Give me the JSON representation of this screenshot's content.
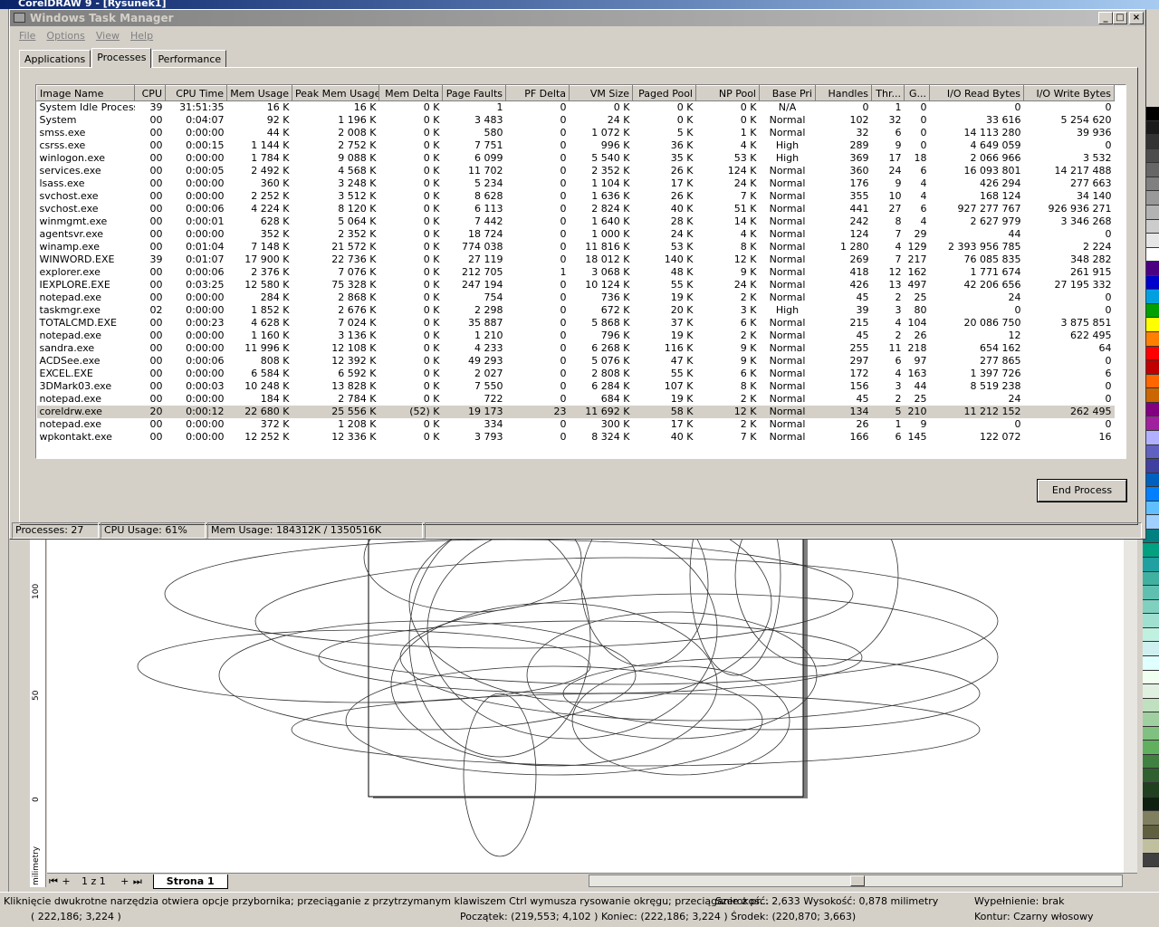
{
  "corel": {
    "title": "CorelDRAW 9 - [Rysunek1]",
    "ruler_unit": "milimetry",
    "ruler_ticks": [
      "100",
      "50",
      "0"
    ],
    "page_counter": "1 z 1",
    "page_tab": "Strona 1",
    "status_hint": "Kliknięcie dwukrotne narzędzia otwiera opcje przybornika; przeciąganie z przytrzymanym klawiszem Ctrl wymusza rysowanie okręgu; przeciąganie z pr...",
    "status_size": "Szerokość: 2,633  Wysokość: 0,878 milimetry",
    "status_fill": "Wypełnienie: brak",
    "status_cursor": "( 222,186; 3,224 )",
    "status_coords": "Początek: (219,553; 4,102 )  Koniec: (222,186; 3,224 )  Środek: (220,870; 3,663)",
    "status_outline": "Kontur:  Czarny włosowy",
    "palette": [
      "#000000",
      "#1a1a1a",
      "#333333",
      "#4d4d4d",
      "#666666",
      "#808080",
      "#999999",
      "#b3b3b3",
      "#cccccc",
      "#e6e6e6",
      "#ffffff",
      "#4b0082",
      "#0000cd",
      "#00a0e0",
      "#00a000",
      "#ffff00",
      "#ff8000",
      "#ff0000",
      "#c00000",
      "#ff6600",
      "#cc6600",
      "#800080",
      "#a020a0",
      "#b0b0ff",
      "#6060c0",
      "#4040a0",
      "#0060c0",
      "#0080ff",
      "#60c0ff",
      "#a0d0ff",
      "#008080",
      "#00a080",
      "#20a0a0",
      "#40b0a0",
      "#60c0b0",
      "#80d0c0",
      "#a0e0d0",
      "#c0f0e0",
      "#d0f0f0",
      "#e0ffff",
      "#f0fff0",
      "#e0f0e0",
      "#c0e0c0",
      "#a0d0a0",
      "#80c080",
      "#60b060",
      "#408040",
      "#306030",
      "#204020",
      "#102010",
      "#808060",
      "#606040",
      "#c0c0a0",
      "#404040"
    ]
  },
  "taskmgr": {
    "title": "Windows Task Manager",
    "window_buttons": [
      "_",
      "□",
      "×"
    ],
    "menu": [
      "File",
      "Options",
      "View",
      "Help"
    ],
    "tabs": [
      "Applications",
      "Processes",
      "Performance"
    ],
    "columns": [
      "Image Name",
      "CPU",
      "CPU Time",
      "Mem Usage",
      "Peak Mem Usage",
      "Mem Delta",
      "Page Faults",
      "PF Delta",
      "VM Size",
      "Paged Pool",
      "NP Pool",
      "Base Pri",
      "Handles",
      "Thr...",
      "G...",
      "I/O Read Bytes",
      "I/O Write Bytes"
    ],
    "rows": [
      [
        "System Idle Process",
        "39",
        "31:51:35",
        "16 K",
        "16 K",
        "0 K",
        "1",
        "0",
        "0 K",
        "0 K",
        "0 K",
        "N/A",
        "0",
        "1",
        "0",
        "0",
        "0"
      ],
      [
        "System",
        "00",
        "0:04:07",
        "92 K",
        "1 196 K",
        "0 K",
        "3 483",
        "0",
        "24 K",
        "0 K",
        "0 K",
        "Normal",
        "102",
        "32",
        "0",
        "33 616",
        "5 254 620"
      ],
      [
        "smss.exe",
        "00",
        "0:00:00",
        "44 K",
        "2 008 K",
        "0 K",
        "580",
        "0",
        "1 072 K",
        "5 K",
        "1 K",
        "Normal",
        "32",
        "6",
        "0",
        "14 113 280",
        "39 936"
      ],
      [
        "csrss.exe",
        "00",
        "0:00:15",
        "1 144 K",
        "2 752 K",
        "0 K",
        "7 751",
        "0",
        "996 K",
        "36 K",
        "4 K",
        "High",
        "289",
        "9",
        "0",
        "4 649 059",
        "0"
      ],
      [
        "winlogon.exe",
        "00",
        "0:00:00",
        "1 784 K",
        "9 088 K",
        "0 K",
        "6 099",
        "0",
        "5 540 K",
        "35 K",
        "53 K",
        "High",
        "369",
        "17",
        "18",
        "2 066 966",
        "3 532"
      ],
      [
        "services.exe",
        "00",
        "0:00:05",
        "2 492 K",
        "4 568 K",
        "0 K",
        "11 702",
        "0",
        "2 352 K",
        "26 K",
        "124 K",
        "Normal",
        "360",
        "24",
        "6",
        "16 093 801",
        "14 217 488"
      ],
      [
        "lsass.exe",
        "00",
        "0:00:00",
        "360 K",
        "3 248 K",
        "0 K",
        "5 234",
        "0",
        "1 104 K",
        "17 K",
        "24 K",
        "Normal",
        "176",
        "9",
        "4",
        "426 294",
        "277 663"
      ],
      [
        "svchost.exe",
        "00",
        "0:00:00",
        "2 252 K",
        "3 512 K",
        "0 K",
        "8 628",
        "0",
        "1 636 K",
        "26 K",
        "7 K",
        "Normal",
        "355",
        "10",
        "4",
        "168 124",
        "34 140"
      ],
      [
        "svchost.exe",
        "00",
        "0:00:06",
        "4 224 K",
        "8 120 K",
        "0 K",
        "6 113",
        "0",
        "2 824 K",
        "40 K",
        "51 K",
        "Normal",
        "441",
        "27",
        "6",
        "927 277 767",
        "926 936 271"
      ],
      [
        "winmgmt.exe",
        "00",
        "0:00:01",
        "628 K",
        "5 064 K",
        "0 K",
        "7 442",
        "0",
        "1 640 K",
        "28 K",
        "14 K",
        "Normal",
        "242",
        "8",
        "4",
        "2 627 979",
        "3 346 268"
      ],
      [
        "agentsvr.exe",
        "00",
        "0:00:00",
        "352 K",
        "2 352 K",
        "0 K",
        "18 724",
        "0",
        "1 000 K",
        "24 K",
        "4 K",
        "Normal",
        "124",
        "7",
        "29",
        "44",
        "0"
      ],
      [
        "winamp.exe",
        "00",
        "0:01:04",
        "7 148 K",
        "21 572 K",
        "0 K",
        "774 038",
        "0",
        "11 816 K",
        "53 K",
        "8 K",
        "Normal",
        "1 280",
        "4",
        "129",
        "2 393 956 785",
        "2 224"
      ],
      [
        "WINWORD.EXE",
        "39",
        "0:01:07",
        "17 900 K",
        "22 736 K",
        "0 K",
        "27 119",
        "0",
        "18 012 K",
        "140 K",
        "12 K",
        "Normal",
        "269",
        "7",
        "217",
        "76 085 835",
        "348 282"
      ],
      [
        "explorer.exe",
        "00",
        "0:00:06",
        "2 376 K",
        "7 076 K",
        "0 K",
        "212 705",
        "1",
        "3 068 K",
        "48 K",
        "9 K",
        "Normal",
        "418",
        "12",
        "162",
        "1 771 674",
        "261 915"
      ],
      [
        "IEXPLORE.EXE",
        "00",
        "0:03:25",
        "12 580 K",
        "75 328 K",
        "0 K",
        "247 194",
        "0",
        "10 124 K",
        "55 K",
        "24 K",
        "Normal",
        "426",
        "13",
        "497",
        "42 206 656",
        "27 195 332"
      ],
      [
        "notepad.exe",
        "00",
        "0:00:00",
        "284 K",
        "2 868 K",
        "0 K",
        "754",
        "0",
        "736 K",
        "19 K",
        "2 K",
        "Normal",
        "45",
        "2",
        "25",
        "24",
        "0"
      ],
      [
        "taskmgr.exe",
        "02",
        "0:00:00",
        "1 852 K",
        "2 676 K",
        "0 K",
        "2 298",
        "0",
        "672 K",
        "20 K",
        "3 K",
        "High",
        "39",
        "3",
        "80",
        "0",
        "0"
      ],
      [
        "TOTALCMD.EXE",
        "00",
        "0:00:23",
        "4 628 K",
        "7 024 K",
        "0 K",
        "35 887",
        "0",
        "5 868 K",
        "37 K",
        "6 K",
        "Normal",
        "215",
        "4",
        "104",
        "20 086 750",
        "3 875 851"
      ],
      [
        "notepad.exe",
        "00",
        "0:00:00",
        "1 160 K",
        "3 136 K",
        "0 K",
        "1 210",
        "0",
        "796 K",
        "19 K",
        "2 K",
        "Normal",
        "45",
        "2",
        "26",
        "12",
        "622 495"
      ],
      [
        "sandra.exe",
        "00",
        "0:00:00",
        "11 996 K",
        "12 108 K",
        "0 K",
        "4 233",
        "0",
        "6 268 K",
        "116 K",
        "9 K",
        "Normal",
        "255",
        "11",
        "218",
        "654 162",
        "64"
      ],
      [
        "ACDSee.exe",
        "00",
        "0:00:06",
        "808 K",
        "12 392 K",
        "0 K",
        "49 293",
        "0",
        "5 076 K",
        "47 K",
        "9 K",
        "Normal",
        "297",
        "6",
        "97",
        "277 865",
        "0"
      ],
      [
        "EXCEL.EXE",
        "00",
        "0:00:00",
        "6 584 K",
        "6 592 K",
        "0 K",
        "2 027",
        "0",
        "2 808 K",
        "55 K",
        "6 K",
        "Normal",
        "172",
        "4",
        "163",
        "1 397 726",
        "6"
      ],
      [
        "3DMark03.exe",
        "00",
        "0:00:03",
        "10 248 K",
        "13 828 K",
        "0 K",
        "7 550",
        "0",
        "6 284 K",
        "107 K",
        "8 K",
        "Normal",
        "156",
        "3",
        "44",
        "8 519 238",
        "0"
      ],
      [
        "notepad.exe",
        "00",
        "0:00:00",
        "184 K",
        "2 784 K",
        "0 K",
        "722",
        "0",
        "684 K",
        "19 K",
        "2 K",
        "Normal",
        "45",
        "2",
        "25",
        "24",
        "0"
      ],
      [
        "coreldrw.exe",
        "20",
        "0:00:12",
        "22 680 K",
        "25 556 K",
        "(52) K",
        "19 173",
        "23",
        "11 692 K",
        "58 K",
        "12 K",
        "Normal",
        "134",
        "5",
        "210",
        "11 212 152",
        "262 495"
      ],
      [
        "notepad.exe",
        "00",
        "0:00:00",
        "372 K",
        "1 208 K",
        "0 K",
        "334",
        "0",
        "300 K",
        "17 K",
        "2 K",
        "Normal",
        "26",
        "1",
        "9",
        "0",
        "0"
      ],
      [
        "wpkontakt.exe",
        "00",
        "0:00:00",
        "12 252 K",
        "12 336 K",
        "0 K",
        "3 793",
        "0",
        "8 324 K",
        "40 K",
        "7 K",
        "Normal",
        "166",
        "6",
        "145",
        "122 072",
        "16"
      ]
    ],
    "selected_row": 24,
    "end_process": "End Process",
    "status_processes": "Processes: 27",
    "status_cpu": "CPU Usage: 61%",
    "status_mem": "Mem Usage: 184312K / 1350516K"
  }
}
